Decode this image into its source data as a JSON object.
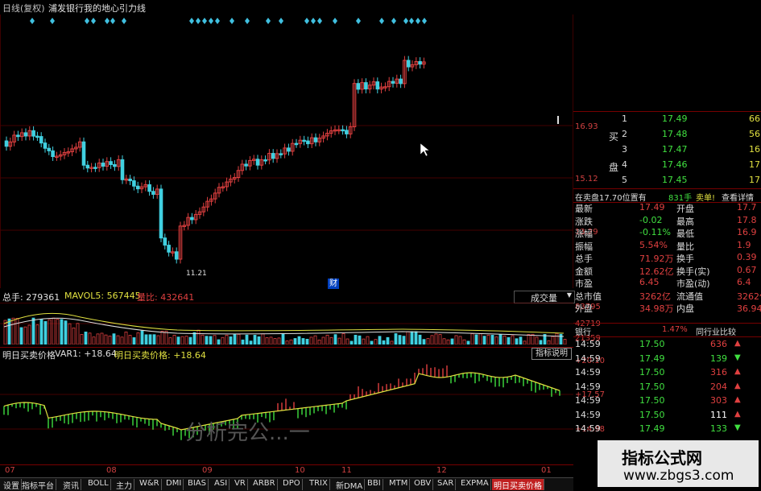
{
  "chart_header": {
    "period": "日线(复权)",
    "stock": "浦发银行",
    "indicator": "我的地心引力线"
  },
  "price_axis": [
    "16.93",
    "15.12",
    "13.29"
  ],
  "low_label": "11.21",
  "marker_char": "财",
  "volume_panel": {
    "total_label": "总手: 279361",
    "mavol_label": "MAVOL5: 567445",
    "ratio_label": "量比: 432641",
    "dropdown": "成交量",
    "axis": [
      "83795",
      "42719",
      "21359"
    ]
  },
  "indicator_panel": {
    "title": "明日买卖价格",
    "var_label": "VAR1: +18.64",
    "value_label": "明日买卖价格: +18.64",
    "help_button": "指标说明",
    "axis": [
      "+20.10",
      "+17.57",
      "+14.98"
    ],
    "watermark": "分析完公...一"
  },
  "date_axis": [
    "07",
    "08",
    "09",
    "10",
    "11",
    "12",
    "01"
  ],
  "tabs": [
    "设置",
    "指标平台",
    "资讯",
    "BOLL",
    "主力",
    "W&R",
    "DMI",
    "BIAS",
    "ASI",
    "VR",
    "ARBR",
    "DPO",
    "TRIX",
    "新DMA",
    "BBI",
    "MTM",
    "OBV",
    "SAR",
    "EXPMA",
    "明日买卖价格"
  ],
  "order_book": {
    "side_label_buy": "买",
    "side_label_sell": "盘",
    "rows": [
      {
        "level": "1",
        "price": "17.49",
        "vol": "66"
      },
      {
        "level": "2",
        "price": "17.48",
        "vol": "56"
      },
      {
        "level": "3",
        "price": "17.47",
        "vol": "16"
      },
      {
        "level": "4",
        "price": "17.46",
        "vol": "17"
      },
      {
        "level": "5",
        "price": "17.45",
        "vol": "17"
      }
    ]
  },
  "notice": {
    "text": "在卖盘17.70位置有",
    "amount": "831手",
    "sell": "卖单!",
    "link": "查看详情"
  },
  "quote": [
    {
      "k1": "最新",
      "v1": "17.49",
      "k2": "开盘",
      "v2": "17.7"
    },
    {
      "k1": "涨跌",
      "v1": "-0.02",
      "k2": "最高",
      "v2": "17.8"
    },
    {
      "k1": "涨幅",
      "v1": "-0.11%",
      "k2": "最低",
      "v2": "16.9"
    },
    {
      "k1": "振幅",
      "v1": "5.54%",
      "k2": "量比",
      "v2": "1.9"
    },
    {
      "k1": "总手",
      "v1": "71.92万",
      "k2": "换手",
      "v2": "0.39"
    },
    {
      "k1": "金额",
      "v1": "12.62亿",
      "k2": "换手(实)",
      "v2": "0.67"
    },
    {
      "k1": "市盈",
      "v1": "6.45",
      "k2": "市盈(动)",
      "v2": "6.4"
    },
    {
      "k1": "总市值",
      "v1": "3262亿",
      "k2": "流通值",
      "v2": "3262亿"
    },
    {
      "k1": "外盘",
      "v1": "34.98万",
      "k2": "内盘",
      "v2": "36.94万"
    }
  ],
  "sector": {
    "name": "银行",
    "change": "1.47%",
    "link": "同行业比较"
  },
  "ticks": [
    {
      "time": "14:59",
      "price": "17.50",
      "vol": "636",
      "dir": "up"
    },
    {
      "time": "14:59",
      "price": "17.49",
      "vol": "139",
      "dir": "down"
    },
    {
      "time": "14:59",
      "price": "17.50",
      "vol": "316",
      "dir": "up"
    },
    {
      "time": "14:59",
      "price": "17.50",
      "vol": "204",
      "dir": "up"
    },
    {
      "time": "14:59",
      "price": "17.50",
      "vol": "303",
      "dir": "up"
    },
    {
      "time": "14:59",
      "price": "17.50",
      "vol": "111",
      "dir": "up"
    },
    {
      "time": "14:59",
      "price": "17.49",
      "vol": "133",
      "dir": "down"
    }
  ],
  "site_watermark": {
    "title": "指标公式网",
    "url": "www.zbgs3.com"
  },
  "colors": {
    "up": "#e04040",
    "down": "#40d0e0",
    "green": "#40e040",
    "yellow": "#e0e040",
    "white": "#e0e0e0"
  }
}
